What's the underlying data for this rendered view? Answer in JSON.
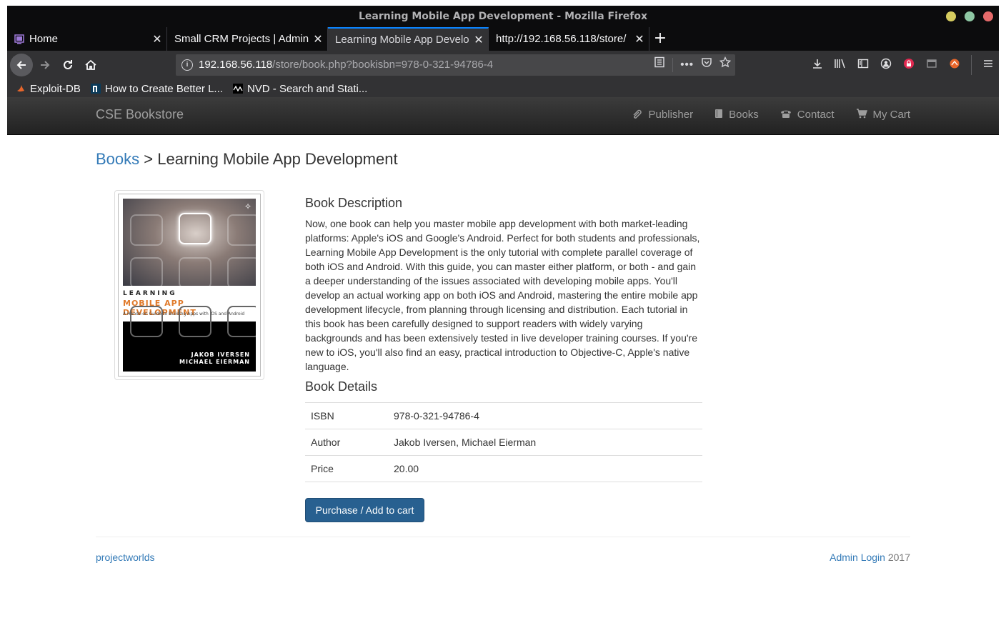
{
  "window": {
    "title": "Learning Mobile App Development - Mozilla Firefox"
  },
  "tabs": [
    {
      "title": "Home",
      "icon": "page-icon",
      "active": false
    },
    {
      "title": "Small CRM Projects | Admin",
      "icon": "none",
      "active": false
    },
    {
      "title": "Learning Mobile App Develop",
      "icon": "none",
      "active": true
    },
    {
      "title": "http://192.168.56.118/store/",
      "icon": "none",
      "active": false
    }
  ],
  "urlbar": {
    "host": "192.168.56.118",
    "path": "/store/book.php?bookisbn=978-0-321-94786-4"
  },
  "bookmarks": [
    {
      "label": "Exploit-DB",
      "icon": "exploit-db-icon"
    },
    {
      "label": "How to Create Better L...",
      "icon": "n-icon"
    },
    {
      "label": "NVD - Search and Stati...",
      "icon": "nvd-icon"
    }
  ],
  "site": {
    "brand": "CSE Bookstore",
    "menu": [
      {
        "label": "Publisher",
        "icon": "paperclip-icon"
      },
      {
        "label": "Books",
        "icon": "book-icon"
      },
      {
        "label": "Contact",
        "icon": "phone-icon"
      },
      {
        "label": "My Cart",
        "icon": "cart-icon"
      }
    ]
  },
  "breadcrumb": {
    "link": "Books",
    "separator": ">",
    "current": "Learning Mobile App Development"
  },
  "cover": {
    "line1": "LEARNING",
    "line2": "MOBILE APP DEVELOPMENT",
    "line3": "A Hands-on Guide to Building Apps with iOS and Android",
    "author1": "JAKOB IVERSEN",
    "author2": "MICHAEL EIERMAN"
  },
  "book": {
    "desc_heading": "Book Description",
    "description": "Now, one book can help you master mobile app development with both market-leading platforms: Apple's iOS and Google's Android. Perfect for both students and professionals, Learning Mobile App Development is the only tutorial with complete parallel coverage of both iOS and Android. With this guide, you can master either platform, or both - and gain a deeper understanding of the issues associated with developing mobile apps. You'll develop an actual working app on both iOS and Android, mastering the entire mobile app development lifecycle, from planning through licensing and distribution. Each tutorial in this book has been carefully designed to support readers with widely varying backgrounds and has been extensively tested in live developer training courses. If you're new to iOS, you'll also find an easy, practical introduction to Objective-C, Apple's native language.",
    "details_heading": "Book Details",
    "details": [
      {
        "key": "ISBN",
        "value": "978-0-321-94786-4"
      },
      {
        "key": "Author",
        "value": "Jakob Iversen, Michael Eierman"
      },
      {
        "key": "Price",
        "value": "20.00"
      }
    ],
    "buy_label": "Purchase / Add to cart"
  },
  "footer": {
    "left": "projectworlds",
    "admin": "Admin Login",
    "year": "2017"
  }
}
